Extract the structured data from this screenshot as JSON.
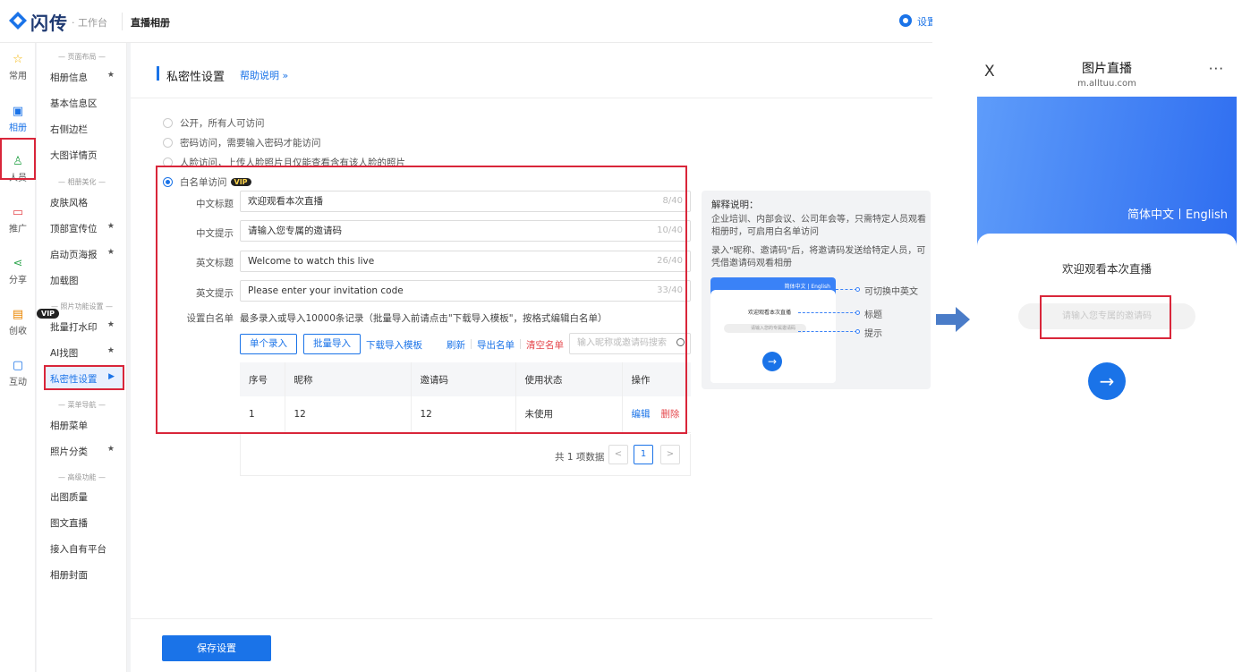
{
  "topbar": {
    "logo": "闪传",
    "logo_sub": "· 工作台",
    "title": "直播相册",
    "settings": "设置"
  },
  "rail": [
    {
      "label": "常用",
      "icon": "star-icon"
    },
    {
      "label": "相册",
      "icon": "album-icon"
    },
    {
      "label": "人员",
      "icon": "people-icon"
    },
    {
      "label": "推广",
      "icon": "promote-icon"
    },
    {
      "label": "分享",
      "icon": "share-icon"
    },
    {
      "label": "创收",
      "icon": "revenue-icon"
    },
    {
      "label": "互动",
      "icon": "interact-icon"
    }
  ],
  "rail_vip": "VIP",
  "submenu": {
    "sections": [
      "— 页面布局 —",
      "— 相册美化 —",
      "— 照片功能设置 —",
      "— 菜单导航 —",
      "— 高级功能 —"
    ],
    "items": [
      {
        "label": "相册信息",
        "star": "★"
      },
      {
        "label": "基本信息区",
        "star": ""
      },
      {
        "label": "右侧边栏",
        "star": ""
      },
      {
        "label": "大图详情页",
        "star": ""
      },
      {
        "label": "皮肤风格",
        "star": ""
      },
      {
        "label": "顶部宣传位",
        "star": "★"
      },
      {
        "label": "启动页海报",
        "star": "★"
      },
      {
        "label": "加载图",
        "star": ""
      },
      {
        "label": "批量打水印",
        "star": "★"
      },
      {
        "label": "AI找图",
        "star": "★"
      },
      {
        "label": "私密性设置",
        "star": "▶"
      },
      {
        "label": "相册菜单",
        "star": ""
      },
      {
        "label": "照片分类",
        "star": "★"
      },
      {
        "label": "出图质量",
        "star": ""
      },
      {
        "label": "图文直播",
        "star": ""
      },
      {
        "label": "接入自有平台",
        "star": ""
      },
      {
        "label": "相册封面",
        "star": ""
      }
    ]
  },
  "main": {
    "section_title": "私密性设置",
    "help_link": "帮助说明 »",
    "radios": [
      {
        "label": "公开，所有人可访问",
        "checked": false
      },
      {
        "label": "密码访问，需要输入密码才能访问",
        "checked": false
      },
      {
        "label": "人脸访问，上传人脸照片且仅能查看含有该人脸的照片",
        "checked": false
      },
      {
        "label": "白名单访问",
        "checked": true,
        "vip": "VIP"
      }
    ],
    "fields": [
      {
        "label": "中文标题",
        "value": "欢迎观看本次直播",
        "count": "8/40"
      },
      {
        "label": "中文提示",
        "value": "请输入您专属的邀请码",
        "count": "10/40"
      },
      {
        "label": "英文标题",
        "value": "Welcome to watch this live",
        "count": "26/40"
      },
      {
        "label": "英文提示",
        "value": "Please enter your invitation code",
        "count": "33/40"
      }
    ],
    "whitelist_label": "设置白名单",
    "whitelist_note": "最多录入或导入10000条记录（批量导入前请点击\"下载导入模板\"，按格式编辑白名单）",
    "buttons": {
      "single": "单个录入",
      "batch": "批量导入",
      "template": "下载导入模板",
      "refresh": "刷新",
      "export": "导出名单",
      "clear": "清空名单"
    },
    "search_placeholder": "输入昵称或邀请码搜索",
    "table": {
      "headers": [
        "序号",
        "昵称",
        "邀请码",
        "使用状态",
        "操作"
      ],
      "rows": [
        {
          "no": "1",
          "nick": "12",
          "code": "12",
          "status": "未使用",
          "edit": "编辑",
          "delete": "删除"
        }
      ]
    },
    "pager": {
      "total": "共 1 项数据",
      "prev": "<",
      "page": "1",
      "next": ">"
    },
    "explain": {
      "title": "解释说明：",
      "p1": "企业培训、内部会议、公司年会等，只需特定人员观看相册时，可启用白名单访问",
      "p2": "录入\"昵称、邀请码\"后，将邀请码发送给特定人员，可凭借邀请码观看相册",
      "mini_lang": "简体中文 | English",
      "mini_title": "欢迎观看本次直播",
      "mini_input": "请输入您的专属邀请码",
      "callouts": [
        "可切换中英文",
        "标题",
        "提示"
      ]
    },
    "save": "保存设置"
  },
  "phone": {
    "close": "X",
    "title": "图片直播",
    "url": "m.alltuu.com",
    "more": "···",
    "lang_cn": "简体中文",
    "lang_en": "English",
    "welcome": "欢迎观看本次直播",
    "placeholder": "请输入您专属的邀请码"
  },
  "colors": {
    "accent": "#1a73e8",
    "highlight": "#d9263a"
  }
}
